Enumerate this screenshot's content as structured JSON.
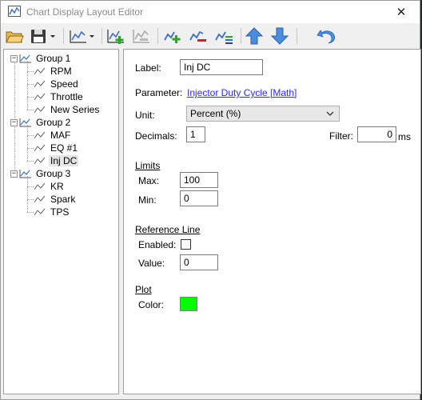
{
  "window": {
    "title": "Chart Display Layout Editor",
    "close_glyph": "✕"
  },
  "toolbar": {
    "buttons": [
      {
        "icon": "folder-open-icon"
      },
      {
        "icon": "save-icon"
      },
      {
        "icon": "chart-dropdown-icon"
      },
      {
        "icon": "add-chart-icon"
      },
      {
        "icon": "remove-chart-icon"
      },
      {
        "icon": "add-series-icon"
      },
      {
        "icon": "remove-series-icon"
      },
      {
        "icon": "series-list-icon"
      },
      {
        "icon": "move-up-icon"
      },
      {
        "icon": "move-down-icon"
      },
      {
        "icon": "undo-icon"
      }
    ]
  },
  "tree": {
    "expander_symbol": "−",
    "groups": [
      {
        "label": "Group 1",
        "items": [
          "RPM",
          "Speed",
          "Throttle",
          "New Series"
        ]
      },
      {
        "label": "Group 2",
        "items": [
          "MAF",
          "EQ #1",
          "Inj DC"
        ]
      },
      {
        "label": "Group 3",
        "items": [
          "KR",
          "Spark",
          "TPS"
        ]
      }
    ],
    "selected": "Inj DC"
  },
  "form": {
    "label_caption": "Label:",
    "label_value": "Inj DC",
    "parameter_caption": "Parameter:",
    "parameter_link": "Injector Duty Cycle [Math]",
    "unit_caption": "Unit:",
    "unit_value": "Percent (%)",
    "decimals_caption": "Decimals:",
    "decimals_value": "1",
    "filter_caption": "Filter:",
    "filter_value": "0",
    "filter_unit": "ms",
    "limits_heading": "Limits",
    "max_caption": "Max:",
    "max_value": "100",
    "min_caption": "Min:",
    "min_value": "0",
    "refline_heading": "Reference Line",
    "enabled_caption": "Enabled:",
    "enabled_checked": false,
    "value_caption": "Value:",
    "value_value": "0",
    "plot_heading": "Plot",
    "color_caption": "Color:",
    "color_value": "#00ff00"
  }
}
